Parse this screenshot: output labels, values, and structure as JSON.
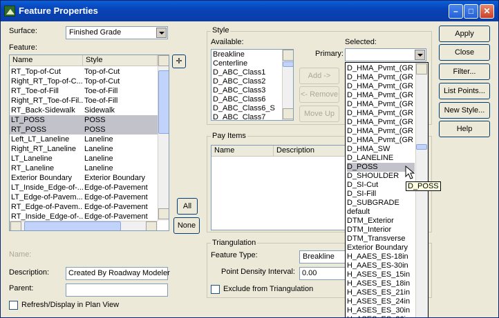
{
  "window": {
    "title": "Feature Properties"
  },
  "surface": {
    "label": "Surface:",
    "value": "Finished Grade"
  },
  "feature": {
    "label": "Feature:",
    "columns": [
      "Name",
      "Style"
    ],
    "rows": [
      {
        "name": "RT_Top-of-Cut",
        "style": "Top-of-Cut",
        "selected": false
      },
      {
        "name": "Right_RT_Top-of-C...",
        "style": "Top-of-Cut",
        "selected": false
      },
      {
        "name": "RT_Toe-of-Fill",
        "style": "Toe-of-Fill",
        "selected": false
      },
      {
        "name": "Right_RT_Toe-of-Fil...",
        "style": "Toe-of-Fill",
        "selected": false
      },
      {
        "name": "RT_Back-Sidewalk",
        "style": "Sidewalk",
        "selected": false
      },
      {
        "name": "LT_POSS",
        "style": "POSS",
        "selected": true
      },
      {
        "name": "RT_POSS",
        "style": "POSS",
        "selected": true
      },
      {
        "name": "Left_LT_Laneline",
        "style": "Laneline",
        "selected": false
      },
      {
        "name": "Right_RT_Laneline",
        "style": "Laneline",
        "selected": false
      },
      {
        "name": "LT_Laneline",
        "style": "Laneline",
        "selected": false
      },
      {
        "name": "RT_Laneline",
        "style": "Laneline",
        "selected": false
      },
      {
        "name": "Exterior Boundary",
        "style": "Exterior Boundary",
        "selected": false
      },
      {
        "name": "LT_Inside_Edge-of-...",
        "style": "Edge-of-Pavement",
        "selected": false
      },
      {
        "name": "LT_Edge-of-Pavem...",
        "style": "Edge-of-Pavement",
        "selected": false
      },
      {
        "name": "RT_Edge-of-Pavem...",
        "style": "Edge-of-Pavement",
        "selected": false
      },
      {
        "name": "RT_Inside_Edge-of-...",
        "style": "Edge-of-Pavement",
        "selected": false
      }
    ],
    "all_button": "All",
    "none_button": "None"
  },
  "name": {
    "label": "Name:"
  },
  "description": {
    "label": "Description:",
    "value": "Created By Roadway Modeler"
  },
  "parent": {
    "label": "Parent:",
    "value": ""
  },
  "refresh": {
    "label": "Refresh/Display in Plan View",
    "checked": false
  },
  "style": {
    "group_label": "Style",
    "available_label": "Available:",
    "available_items": [
      "Breakline",
      "Centerline",
      "D_ABC_Class1",
      "D_ABC_Class2",
      "D_ABC_Class3",
      "D_ABC_Class6",
      "D_ABC_Class6_S",
      "D_ABC_Class7"
    ],
    "selected_label": "Selected:",
    "primary_label": "Primary:",
    "primary_value": "",
    "add_button": "Add ->",
    "remove_button": "<- Remove",
    "move_up_button": "Move Up"
  },
  "pay_items": {
    "group_label": "Pay Items",
    "columns": [
      "Name",
      "Description"
    ]
  },
  "triangulation": {
    "group_label": "Triangulation",
    "feature_type_label": "Feature Type:",
    "feature_type_value": "Breakline",
    "density_label": "Point Density Interval:",
    "density_value": "0.00",
    "exclude_label": "Exclude from Triangulation",
    "exclude_checked": false
  },
  "dropdown": {
    "items": [
      "D_HMA_Pvmt_(GR S",
      "D_HMA_Pvmt_(GR S",
      "D_HMA_Pvmt_(GR S",
      "D_HMA_Pvmt_(GR S",
      "D_HMA_Pvmt_(GR S",
      "D_HMA_Pvmt_(GR S",
      "D_HMA_Pvmt_(GR S",
      "D_HMA_Pvmt_(GR S",
      "D_HMA_Pvmt_(GR S",
      "D_HMA_SW",
      "D_LANELINE",
      "D_POSS",
      "D_SHOULDER",
      "D_SI-Cut",
      "D_SI-Fill",
      "D_SUBGRADE",
      "default",
      "DTM_Exterior",
      "DTM_Interior",
      "DTM_Transverse",
      "Exterior Boundary",
      "H_AAES_ES-18in",
      "H_AAES_ES-30in",
      "H_ASES_ES_15in",
      "H_ASES_ES_18in",
      "H_ASES_ES_21in",
      "H_ASES_ES_24in",
      "H_ASES_ES_30in",
      "H_ASES_ES_36in"
    ],
    "hovered_index": 11,
    "tooltip": "D_POSS"
  },
  "buttons": {
    "apply": "Apply",
    "close": "Close",
    "filter": "Filter...",
    "list_points": "List Points...",
    "new_style": "New Style...",
    "help": "Help"
  },
  "colors": {
    "title_bar": "#0a5fd8",
    "selection": "#c2c2cb",
    "tooltip_bg": "#ffffe1"
  }
}
